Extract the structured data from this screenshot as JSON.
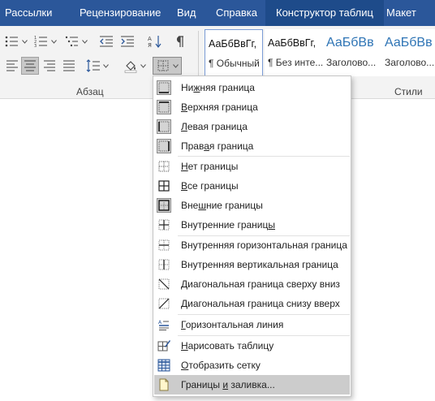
{
  "tabs": [
    "Рассылки",
    "Рецензирование",
    "Вид",
    "Справка",
    "Конструктор таблиц",
    "Макет"
  ],
  "active_tab": "Конструктор таблиц",
  "ribbon": {
    "paragraph_label": "Абзац",
    "styles_label": "Стили",
    "styles": [
      {
        "sample": "АаБбВвГг,",
        "name": "¶ Обычный"
      },
      {
        "sample": "АаБбВвГг,",
        "name": "¶ Без инте..."
      },
      {
        "sample": "АаБбВв",
        "name": "Заголово..."
      },
      {
        "sample": "АаБбВв",
        "name": "Заголово..."
      }
    ]
  },
  "menu": {
    "items": [
      {
        "pre": "Ни",
        "key": "ж",
        "post": "няя граница",
        "icon": "bottom-border-icon"
      },
      {
        "pre": "",
        "key": "В",
        "post": "ерхняя граница",
        "icon": "top-border-icon"
      },
      {
        "pre": "",
        "key": "Л",
        "post": "евая граница",
        "icon": "left-border-icon"
      },
      {
        "pre": "Прав",
        "key": "а",
        "post": "я граница",
        "icon": "right-border-icon"
      },
      {
        "pre": "",
        "key": "Н",
        "post": "ет границы",
        "icon": "no-border-icon"
      },
      {
        "pre": "",
        "key": "В",
        "post": "се границы",
        "icon": "all-borders-icon"
      },
      {
        "pre": "Вне",
        "key": "ш",
        "post": "ние границы",
        "icon": "outside-borders-icon"
      },
      {
        "pre": "Внутренние границ",
        "key": "ы",
        "post": "",
        "icon": "inside-borders-icon"
      },
      {
        "pre": "Внутренняя горизонтальная граница",
        "key": "",
        "post": "",
        "icon": "inside-horizontal-border-icon"
      },
      {
        "pre": "Внутренняя вертикальная граница",
        "key": "",
        "post": "",
        "icon": "inside-vertical-border-icon"
      },
      {
        "pre": "Диагональная граница сверху вниз",
        "key": "",
        "post": "",
        "icon": "diagonal-down-border-icon"
      },
      {
        "pre": "Диагональная граница снизу вверх",
        "key": "",
        "post": "",
        "icon": "diagonal-up-border-icon"
      },
      {
        "pre": "",
        "key": "Г",
        "post": "оризонтальная линия",
        "icon": "horizontal-line-icon"
      },
      {
        "pre": "",
        "key": "Н",
        "post": "арисовать таблицу",
        "icon": "draw-table-icon"
      },
      {
        "pre": "",
        "key": "О",
        "post": "тобразить сетку",
        "icon": "view-gridlines-icon"
      },
      {
        "pre": "Границы ",
        "key": "и",
        "post": " заливка...",
        "icon": "borders-and-shading-icon"
      }
    ]
  },
  "colors": {
    "tab_bar": "#2b579a",
    "active_tab": "#1e4b8a",
    "heading_style": "#2e74b5",
    "menu_highlight": "#cccccc"
  }
}
